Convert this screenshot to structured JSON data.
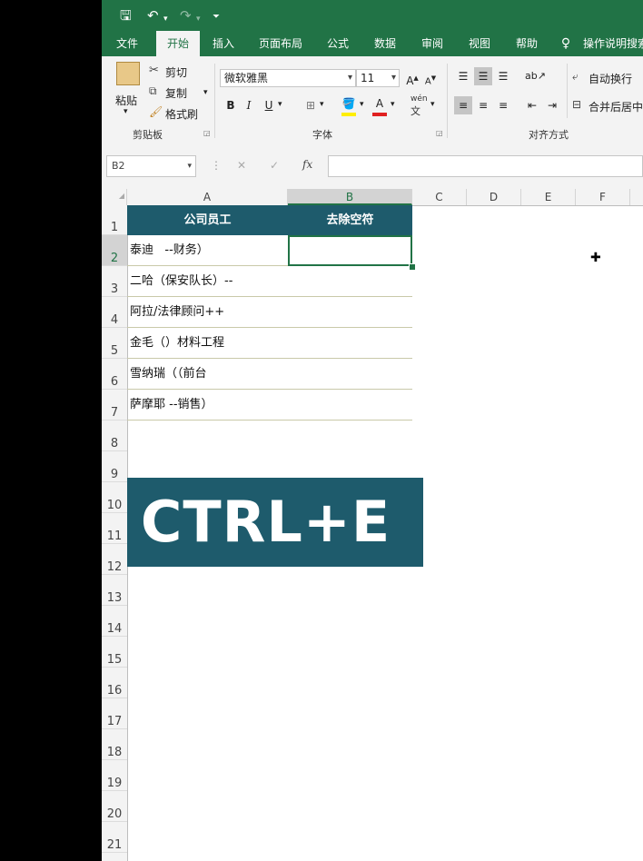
{
  "quick_access": {
    "save_icon": "save-icon",
    "undo_icon": "undo-icon",
    "redo_icon": "redo-icon",
    "customize_icon": "customize-icon",
    "save_glyph": "🖫",
    "undo_glyph": "↶",
    "redo_glyph": "↷",
    "customize_glyph": "⏷"
  },
  "menu": {
    "tabs": [
      "文件",
      "开始",
      "插入",
      "页面布局",
      "公式",
      "数据",
      "审阅",
      "视图",
      "帮助"
    ],
    "active": "开始",
    "tell_me": "操作说明搜索",
    "tell_me_glyph": "♀"
  },
  "ribbon": {
    "clipboard": {
      "paste": "粘贴",
      "cut": "剪切",
      "copy": "复制",
      "format_painter": "格式刷",
      "group_label": "剪贴板"
    },
    "font": {
      "font_name": "微软雅黑",
      "font_size": "11",
      "grow": "A",
      "shrink": "A",
      "bold": "B",
      "italic": "I",
      "underline": "U",
      "phonetic": "wén",
      "group_label": "字体",
      "font_color_accent": "#e02020",
      "fill_color_accent": "#ffee00"
    },
    "alignment": {
      "wrap_text": "自动换行",
      "merge_center": "合并后居中",
      "group_label": "对齐方式"
    }
  },
  "formula_bar": {
    "name_box": "B2",
    "cancel": "✕",
    "enter": "✓",
    "fx": "fx",
    "formula": ""
  },
  "sheet": {
    "columns": [
      "A",
      "B",
      "C",
      "D",
      "E",
      "F"
    ],
    "selected_column": "B",
    "rows": [
      "1",
      "2",
      "3",
      "4",
      "5",
      "6",
      "7",
      "8",
      "9",
      "10",
      "11",
      "12",
      "13",
      "14",
      "15",
      "16",
      "17",
      "18",
      "19",
      "20",
      "21"
    ],
    "selected_row": "2",
    "header": [
      "公司员工",
      "去除空符"
    ],
    "data": [
      "泰迪   --财务）",
      "二哈（保安队长）--",
      "阿拉/法律顾问++",
      "金毛（）材料工程",
      "雪纳瑞（（前台",
      "萨摩耶 --销售）"
    ],
    "active_cell": "B2",
    "header_color": "#1e5b6c",
    "accent_color": "#217346"
  },
  "banner": {
    "text": "CTRL+E",
    "color": "#1e5b6c"
  }
}
